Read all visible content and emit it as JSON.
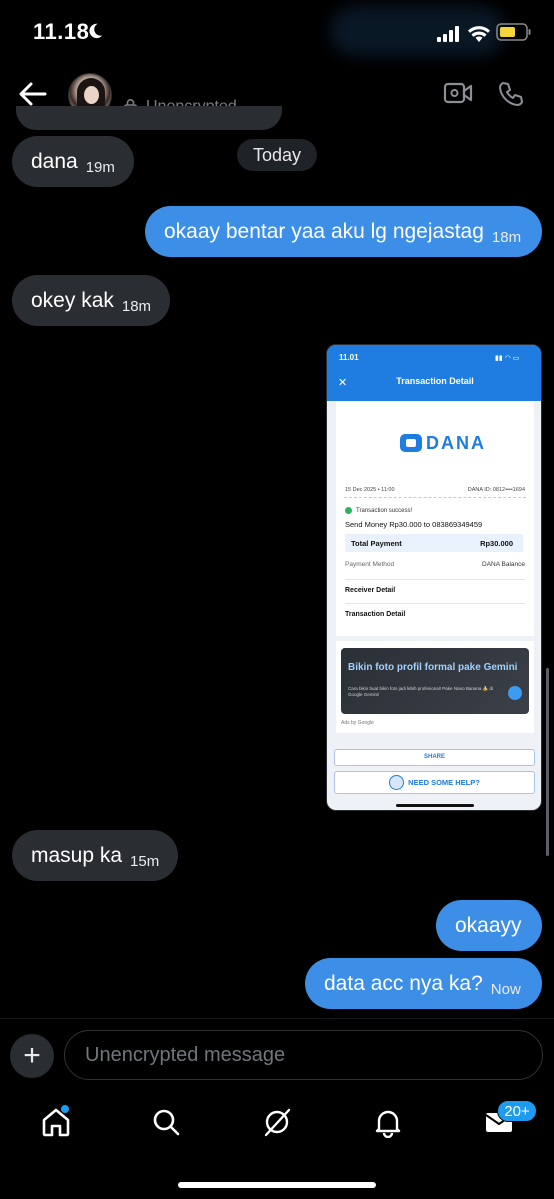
{
  "status_bar": {
    "time": "11.18"
  },
  "header": {
    "encryption_label": "Unencrypted"
  },
  "messages": [
    {
      "direction": "in",
      "text": "dana",
      "time": "19m"
    },
    {
      "direction": "out",
      "text": "okaay bentar yaa aku lg ngejastag",
      "time": "18m"
    },
    {
      "direction": "in",
      "text": "okey kak",
      "time": "18m"
    },
    {
      "direction": "out",
      "type": "image",
      "attachment": "screenshot"
    },
    {
      "direction": "in",
      "text": "masup ka",
      "time": "15m"
    },
    {
      "direction": "out",
      "text": "okaayy",
      "time": ""
    },
    {
      "direction": "out",
      "text": "data acc nya ka?",
      "time": "Now"
    }
  ],
  "date_separator": "Today",
  "attachment": {
    "time": "11.01",
    "title": "Transaction Detail",
    "brand": "DANA",
    "date": "15 Dec 2025 • 11:00",
    "dana_id": "DANA ID: 0812••••1694",
    "success": "Transaction success!",
    "send_line": "Send Money Rp30.000 to 083869349459",
    "total_label": "Total Payment",
    "total_value": "Rp30.000",
    "method_label": "Payment Method",
    "method_value": "DANA Balance",
    "receiver_label": "Receiver Detail",
    "transaction_label": "Transaction Detail",
    "ad_headline": "Bikin foto profil formal pake Gemini",
    "ad_sub": "Cara bikin buat bikin foto jadi lebih profesional! Pake Nano Banana 🍌 di Google Gemini!",
    "ad_by": "Ads by Google",
    "share_label": "SHARE",
    "help_label": "NEED SOME HELP?"
  },
  "composer": {
    "placeholder": "Unencrypted message"
  },
  "nav": {
    "mail_badge": "20+"
  },
  "colors": {
    "outgoing": "#3d8ee6",
    "incoming": "#2a2d32",
    "accent": "#1d9bf0",
    "dana_blue": "#1f7ce0"
  },
  "icons": [
    "moon-icon",
    "signal-icon",
    "wifi-icon",
    "battery-icon",
    "back-arrow-icon",
    "lock-icon",
    "video-call-icon",
    "phone-icon",
    "plus-icon",
    "home-icon",
    "search-icon",
    "grok-icon",
    "bell-icon",
    "mail-icon"
  ]
}
